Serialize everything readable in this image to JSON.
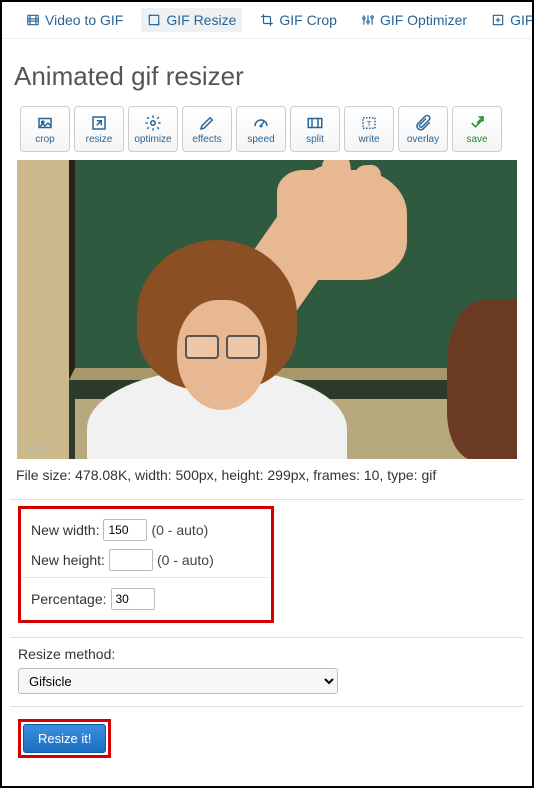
{
  "topnav": {
    "items": [
      {
        "label": "Video to GIF"
      },
      {
        "label": "GIF Resize"
      },
      {
        "label": "GIF Crop"
      },
      {
        "label": "GIF Optimizer"
      },
      {
        "label": "GIF"
      }
    ],
    "active_index": 1
  },
  "page_title": "Animated gif resizer",
  "tools": [
    {
      "label": "crop"
    },
    {
      "label": "resize"
    },
    {
      "label": "optimize"
    },
    {
      "label": "effects"
    },
    {
      "label": "speed"
    },
    {
      "label": "split"
    },
    {
      "label": "write"
    },
    {
      "label": "overlay"
    },
    {
      "label": "save"
    }
  ],
  "preview": {
    "watermark": "IWDRM"
  },
  "file_info": "File size: 478.08K, width: 500px, height: 299px, frames: 10, type: gif",
  "resize_form": {
    "width_label": "New width:",
    "width_value": "150",
    "height_label": "New height:",
    "height_value": "",
    "hint": "(0 - auto)",
    "percentage_label": "Percentage:",
    "percentage_value": "30"
  },
  "method": {
    "label": "Resize method:",
    "selected": "Gifsicle"
  },
  "submit_label": "Resize it!"
}
